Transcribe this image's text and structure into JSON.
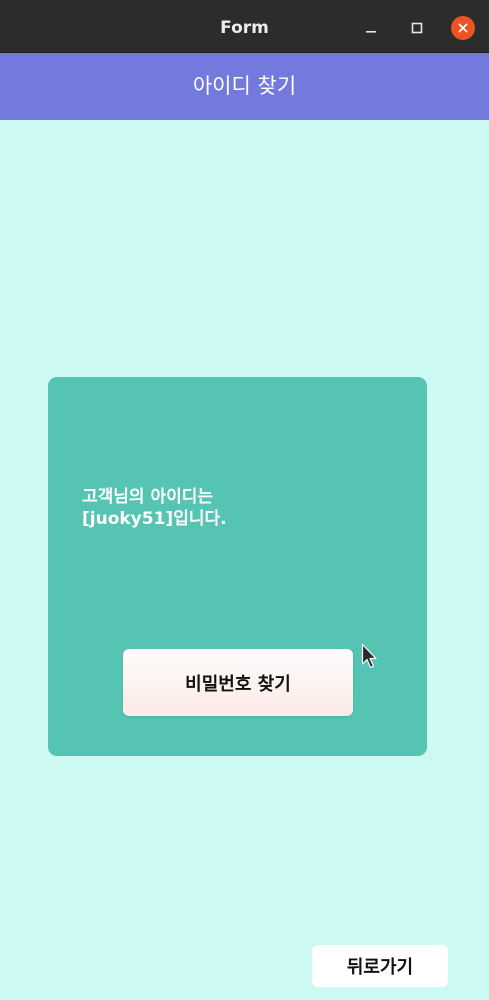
{
  "window": {
    "title": "Form"
  },
  "header": {
    "title": "아이디 찾기",
    "background": "#7479de"
  },
  "result_card": {
    "line1": "고객님의 아이디는",
    "line2": "[juoky51]입니다.",
    "background": "#55c4b3",
    "find_password_label": "비밀번호 찾기"
  },
  "footer": {
    "back_label": "뒤로가기"
  },
  "colors": {
    "page_background": "#ccfaf2",
    "titlebar": "#2c2c2c",
    "close_button": "#e95420"
  },
  "icons": {
    "minimize": "minimize-icon",
    "maximize": "maximize-icon",
    "close": "close-icon",
    "cursor": "mouse-pointer-icon"
  }
}
